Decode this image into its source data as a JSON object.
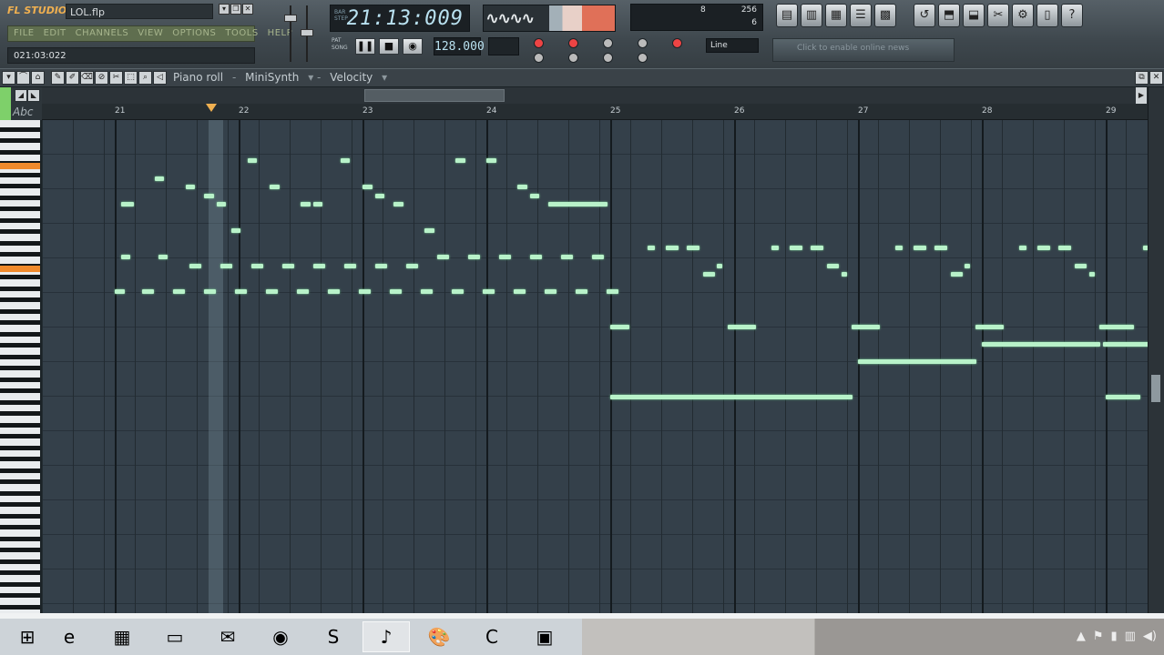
{
  "app": {
    "logo": "FL STUDIO",
    "filename": "LOL.flp",
    "window_controls": [
      "minimize",
      "restore",
      "close"
    ]
  },
  "menu": [
    "FILE",
    "EDIT",
    "CHANNELS",
    "VIEW",
    "OPTIONS",
    "TOOLS",
    "HELP"
  ],
  "hint_bar": "021:03:022",
  "transport": {
    "time": "21:13:009",
    "mode_labels": [
      "PAT",
      "SONG"
    ],
    "tempo": "128.000"
  },
  "monitor": {
    "polyphony": "8",
    "buffer": "256",
    "cpu": "6"
  },
  "snap_mode": "Line",
  "news_text": "Click to enable online news",
  "piano_roll": {
    "title": "Piano roll",
    "instrument": "MiniSynth",
    "target": "Velocity",
    "keyboard_label": "Abc"
  },
  "timeline_bars": [
    "21",
    "22",
    "23",
    "24",
    "25",
    "26",
    "27",
    "28",
    "29"
  ],
  "taskbar_apps": [
    {
      "name": "start",
      "icon": "⊞"
    },
    {
      "name": "internet-explorer",
      "icon": "e"
    },
    {
      "name": "spreadsheet",
      "icon": "▦"
    },
    {
      "name": "file-explorer",
      "icon": "▭"
    },
    {
      "name": "mail",
      "icon": "✉"
    },
    {
      "name": "chrome",
      "icon": "◉"
    },
    {
      "name": "skype",
      "icon": "S"
    },
    {
      "name": "fl-studio",
      "icon": "♪"
    },
    {
      "name": "paint",
      "icon": "🎨"
    },
    {
      "name": "camtasia",
      "icon": "C"
    },
    {
      "name": "remote-desktop",
      "icon": "▣"
    }
  ],
  "colors": {
    "note": "#b8f2c9",
    "grid": "#34404a",
    "playhead_marker": "#f0b050",
    "key_highlight": "#f08a2c"
  },
  "notes": [
    {
      "start": 20.05,
      "end": 20.18,
      "row": 9
    },
    {
      "start": 20.32,
      "end": 20.42,
      "row": 6
    },
    {
      "start": 20.57,
      "end": 20.67,
      "row": 7
    },
    {
      "start": 20.72,
      "end": 20.82,
      "row": 8
    },
    {
      "start": 20.82,
      "end": 20.92,
      "row": 9
    },
    {
      "start": 20.94,
      "end": 21.04,
      "row": 12
    },
    {
      "start": 21.07,
      "end": 21.17,
      "row": 4
    },
    {
      "start": 21.25,
      "end": 21.35,
      "row": 7
    },
    {
      "start": 21.5,
      "end": 21.6,
      "row": 9
    },
    {
      "start": 21.6,
      "end": 21.7,
      "row": 9
    },
    {
      "start": 21.82,
      "end": 21.92,
      "row": 4
    },
    {
      "start": 22.0,
      "end": 22.1,
      "row": 7
    },
    {
      "start": 22.1,
      "end": 22.2,
      "row": 8
    },
    {
      "start": 22.25,
      "end": 22.35,
      "row": 9
    },
    {
      "start": 22.5,
      "end": 22.6,
      "row": 12
    },
    {
      "start": 22.75,
      "end": 22.85,
      "row": 4
    },
    {
      "start": 23.0,
      "end": 23.1,
      "row": 4
    },
    {
      "start": 23.25,
      "end": 23.35,
      "row": 7
    },
    {
      "start": 23.35,
      "end": 23.45,
      "row": 8
    },
    {
      "start": 23.5,
      "end": 24.0,
      "row": 9
    }
  ],
  "notes_lane2": [
    {
      "start": 20.05,
      "end": 20.15,
      "row": 15
    },
    {
      "start": 20.35,
      "end": 20.45,
      "row": 15
    },
    {
      "start": 20.6,
      "end": 20.72,
      "row": 16
    },
    {
      "start": 20.85,
      "end": 20.97,
      "row": 16
    },
    {
      "start": 21.1,
      "end": 21.22,
      "row": 16
    },
    {
      "start": 21.35,
      "end": 21.47,
      "row": 16
    },
    {
      "start": 21.6,
      "end": 21.72,
      "row": 16
    },
    {
      "start": 21.85,
      "end": 21.97,
      "row": 16
    },
    {
      "start": 22.1,
      "end": 22.22,
      "row": 16
    },
    {
      "start": 22.35,
      "end": 22.47,
      "row": 16
    },
    {
      "start": 22.6,
      "end": 22.72,
      "row": 15
    },
    {
      "start": 22.85,
      "end": 22.97,
      "row": 15
    },
    {
      "start": 23.1,
      "end": 23.22,
      "row": 15
    },
    {
      "start": 23.35,
      "end": 23.47,
      "row": 15
    },
    {
      "start": 23.6,
      "end": 23.72,
      "row": 15
    },
    {
      "start": 23.85,
      "end": 23.97,
      "row": 15
    }
  ],
  "notes_lane3": [
    {
      "start": 20.0,
      "end": 20.1,
      "row": 19
    },
    {
      "start": 20.22,
      "end": 20.34,
      "row": 19
    },
    {
      "start": 20.47,
      "end": 20.59,
      "row": 19
    },
    {
      "start": 20.72,
      "end": 20.84,
      "row": 19
    },
    {
      "start": 20.97,
      "end": 21.09,
      "row": 19
    },
    {
      "start": 21.22,
      "end": 21.34,
      "row": 19
    },
    {
      "start": 21.47,
      "end": 21.59,
      "row": 19
    },
    {
      "start": 21.72,
      "end": 21.84,
      "row": 19
    },
    {
      "start": 21.97,
      "end": 22.09,
      "row": 19
    },
    {
      "start": 22.22,
      "end": 22.34,
      "row": 19
    },
    {
      "start": 22.47,
      "end": 22.59,
      "row": 19
    },
    {
      "start": 22.72,
      "end": 22.84,
      "row": 19
    },
    {
      "start": 22.97,
      "end": 23.09,
      "row": 19
    },
    {
      "start": 23.22,
      "end": 23.34,
      "row": 19
    },
    {
      "start": 23.47,
      "end": 23.59,
      "row": 19
    },
    {
      "start": 23.72,
      "end": 23.84,
      "row": 19
    },
    {
      "start": 23.97,
      "end": 24.09,
      "row": 19
    }
  ],
  "notes_lane4": [
    {
      "start": 24.3,
      "end": 24.38,
      "row": 14
    },
    {
      "start": 24.45,
      "end": 24.57,
      "row": 14
    },
    {
      "start": 24.62,
      "end": 24.74,
      "row": 14
    },
    {
      "start": 24.75,
      "end": 24.87,
      "row": 17
    },
    {
      "start": 24.86,
      "end": 24.92,
      "row": 16
    },
    {
      "start": 25.3,
      "end": 25.38,
      "row": 14
    },
    {
      "start": 25.45,
      "end": 25.57,
      "row": 14
    },
    {
      "start": 25.62,
      "end": 25.74,
      "row": 14
    },
    {
      "start": 25.75,
      "end": 25.87,
      "row": 16
    },
    {
      "start": 25.87,
      "end": 25.93,
      "row": 17
    },
    {
      "start": 26.3,
      "end": 26.38,
      "row": 14
    },
    {
      "start": 26.45,
      "end": 26.57,
      "row": 14
    },
    {
      "start": 26.62,
      "end": 26.74,
      "row": 14
    },
    {
      "start": 26.75,
      "end": 26.87,
      "row": 17
    },
    {
      "start": 26.86,
      "end": 26.92,
      "row": 16
    },
    {
      "start": 27.3,
      "end": 27.38,
      "row": 14
    },
    {
      "start": 27.45,
      "end": 27.57,
      "row": 14
    },
    {
      "start": 27.62,
      "end": 27.74,
      "row": 14
    },
    {
      "start": 27.75,
      "end": 27.87,
      "row": 16
    },
    {
      "start": 27.87,
      "end": 27.93,
      "row": 17
    },
    {
      "start": 28.3,
      "end": 28.34,
      "row": 14
    }
  ],
  "notes_lane5": [
    {
      "start": 24.0,
      "end": 24.18,
      "row": 23
    },
    {
      "start": 24.95,
      "end": 25.2,
      "row": 23
    },
    {
      "start": 25.95,
      "end": 26.2,
      "row": 23
    },
    {
      "start": 26.95,
      "end": 27.2,
      "row": 23
    },
    {
      "start": 27.95,
      "end": 28.25,
      "row": 23
    },
    {
      "start": 27.0,
      "end": 27.98,
      "row": 25
    },
    {
      "start": 27.98,
      "end": 28.98,
      "row": 25
    },
    {
      "start": 26.0,
      "end": 26.98,
      "row": 27
    },
    {
      "start": 24.0,
      "end": 25.98,
      "row": 31
    },
    {
      "start": 28.0,
      "end": 28.3,
      "row": 31
    }
  ]
}
